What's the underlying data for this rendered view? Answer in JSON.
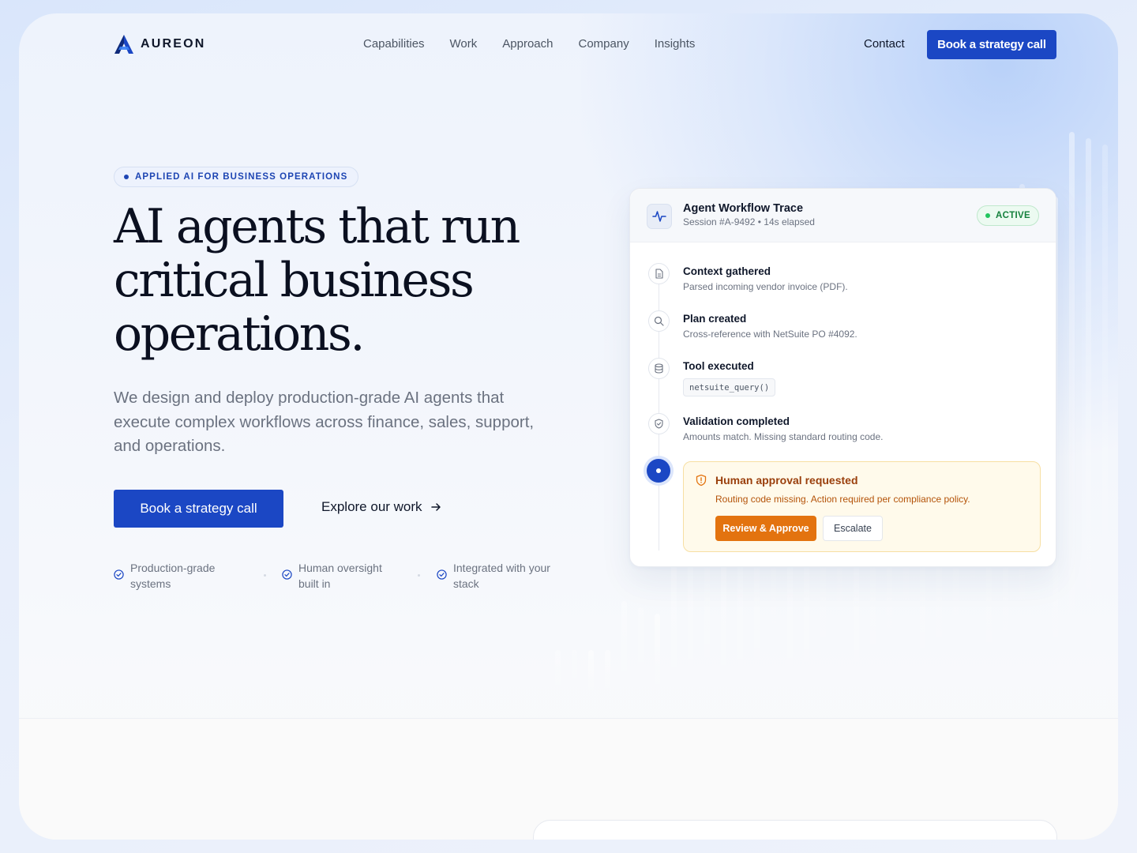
{
  "brand": {
    "name": "AUREON",
    "accent": "#1b47c4"
  },
  "nav": {
    "links": [
      "Capabilities",
      "Work",
      "Approach",
      "Company",
      "Insights"
    ],
    "contact": "Contact",
    "cta": "Book a strategy call"
  },
  "hero": {
    "badge": "APPLIED AI FOR BUSINESS OPERATIONS",
    "title": "AI agents that run critical business operations.",
    "subtitle": "We design and deploy production-grade AI agents that execute complex workflows across finance, sales, support, and operations.",
    "primary_cta": "Book a strategy call",
    "secondary_cta": "Explore our work",
    "features": [
      "Production-grade systems",
      "Human oversight built in",
      "Integrated with your stack"
    ]
  },
  "workflow": {
    "title": "Agent Workflow Trace",
    "meta": "Session #A-9492 • 14s elapsed",
    "status": "ACTIVE",
    "status_color": "#22c55e",
    "steps": [
      {
        "icon": "document-icon",
        "title": "Context gathered",
        "desc": "Parsed incoming vendor invoice (PDF)."
      },
      {
        "icon": "search-icon",
        "title": "Plan created",
        "desc": "Cross-reference with NetSuite PO #4092."
      },
      {
        "icon": "database-icon",
        "title": "Tool executed",
        "code": "netsuite_query()"
      },
      {
        "icon": "shield-check-icon",
        "title": "Validation completed",
        "desc": "Amounts match. Missing standard routing code."
      }
    ],
    "approval": {
      "title": "Human approval requested",
      "desc": "Routing code missing. Action required per compliance policy.",
      "approve": "Review & Approve",
      "escalate": "Escalate",
      "color": "#e3730f"
    }
  }
}
